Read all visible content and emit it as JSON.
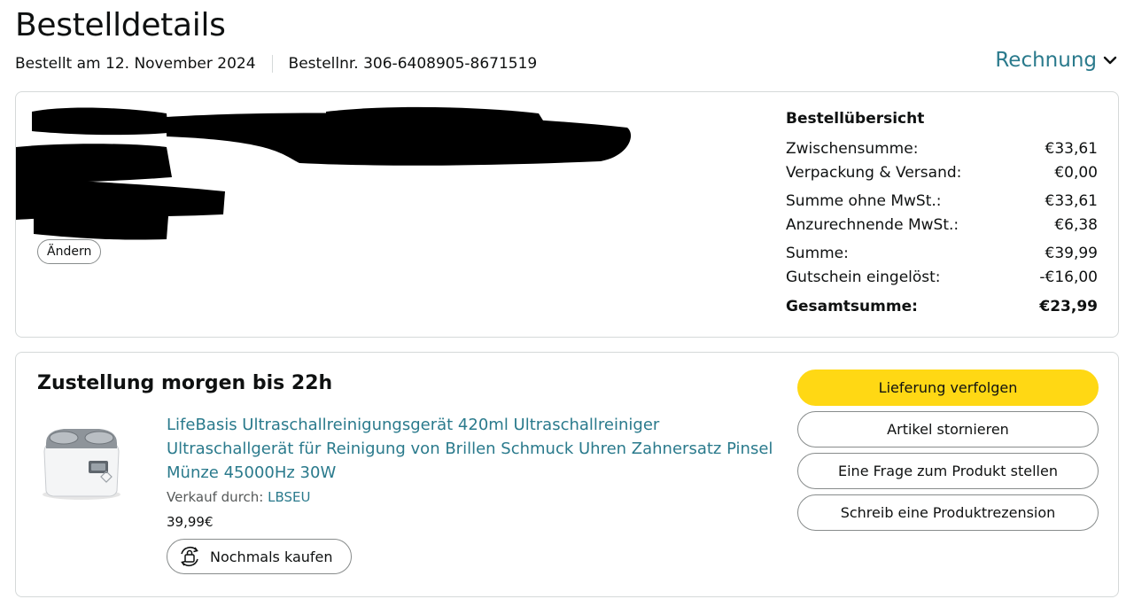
{
  "header": {
    "title": "Bestelldetails",
    "order_date": "Bestellt am 12. November 2024",
    "order_number": "Bestellnr. 306-6408905-8671519",
    "invoice_label": "Rechnung"
  },
  "address": {
    "change_button": "Ändern"
  },
  "summary": {
    "title": "Bestellübersicht",
    "rows": [
      {
        "label": "Zwischensumme:",
        "value": "€33,61"
      },
      {
        "label": "Verpackung & Versand:",
        "value": "€0,00"
      },
      {
        "label": "Summe ohne MwSt.:",
        "value": "€33,61"
      },
      {
        "label": "Anzurechnende MwSt.:",
        "value": "€6,38"
      },
      {
        "label": "Summe:",
        "value": "€39,99"
      },
      {
        "label": "Gutschein eingelöst:",
        "value": "-€16,00"
      },
      {
        "label": "Gesamtsumme:",
        "value": "€23,99"
      }
    ]
  },
  "shipment": {
    "delivery_title": "Zustellung morgen bis 22h",
    "product_title": "LifeBasis Ultraschallreinigungsgerät 420ml Ultraschallreiniger Ultraschallgerät für Reinigung von Brillen Schmuck Uhren Zahnersatz Pinsel Münze 45000Hz 30W",
    "seller_prefix": "Verkauf durch: ",
    "seller_name": "LBSEU",
    "price": "39,99€",
    "rebuy_label": "Nochmals kaufen",
    "actions": {
      "track": "Lieferung verfolgen",
      "cancel": "Artikel stornieren",
      "question": "Eine Frage zum Produkt stellen",
      "review": "Schreib eine Produktrezension"
    }
  },
  "colors": {
    "link": "#2a7a8c",
    "primary_button": "#ffd814",
    "border": "#d5d9d9"
  }
}
